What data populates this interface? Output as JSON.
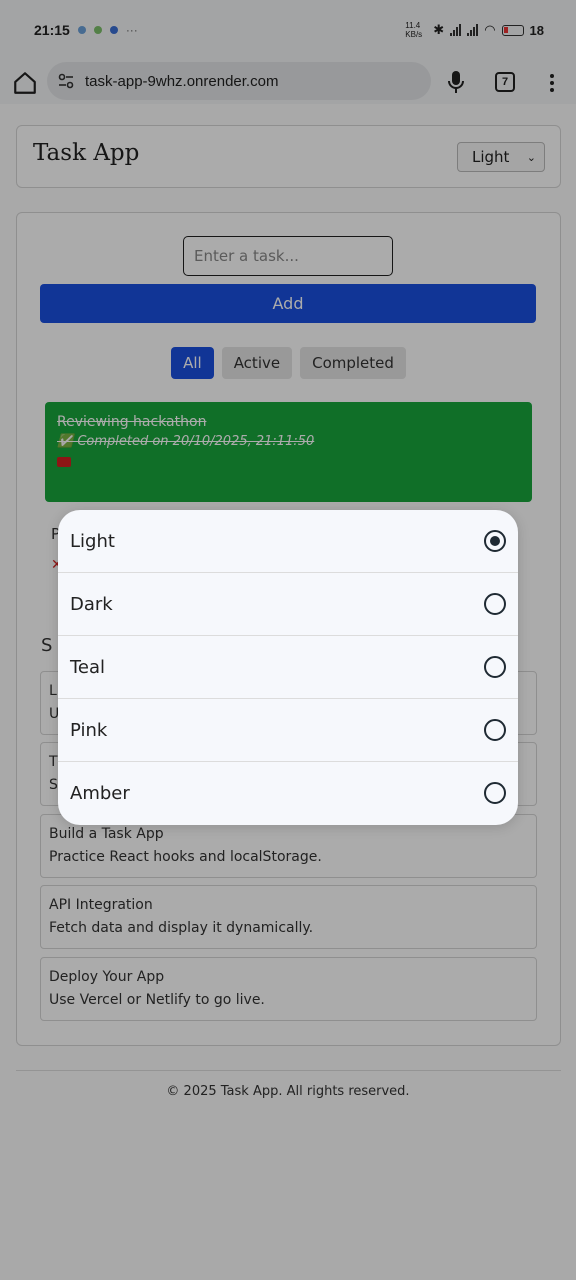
{
  "status": {
    "time": "21:15",
    "extra": "···",
    "net_speed": "11.4 KB/s",
    "battery": "18"
  },
  "browser": {
    "url": "task-app-9whz.onrender.com",
    "tab_count": "7"
  },
  "header": {
    "title": "Task App",
    "theme_value": "Light"
  },
  "form": {
    "placeholder": "Enter a task...",
    "add_label": "Add"
  },
  "filters": [
    "All",
    "Active",
    "Completed"
  ],
  "active_filter": "All",
  "tasks": [
    {
      "title": "Reviewing hackathon",
      "completed_text": "✅ Completed on 20/10/2025, 21:11:50"
    }
  ],
  "partial": {
    "task2_initial": "P",
    "task2_x": "✕",
    "suggest_initial": "S",
    "row1_initials": [
      "L",
      "U"
    ],
    "row2_initials": [
      "T",
      "S"
    ]
  },
  "suggestions": [
    {
      "title": "Build a Task App",
      "desc": "Practice React hooks and localStorage."
    },
    {
      "title": "API Integration",
      "desc": "Fetch data and display it dynamically."
    },
    {
      "title": "Deploy Your App",
      "desc": "Use Vercel or Netlify to go live."
    }
  ],
  "footer": {
    "text": "© 2025 Task App. All rights reserved."
  },
  "theme_dialog": {
    "options": [
      "Light",
      "Dark",
      "Teal",
      "Pink",
      "Amber"
    ],
    "selected": "Light"
  },
  "colors": {
    "primary": "#1a4fe0",
    "completed": "#18a63c",
    "delete": "#d32020"
  }
}
